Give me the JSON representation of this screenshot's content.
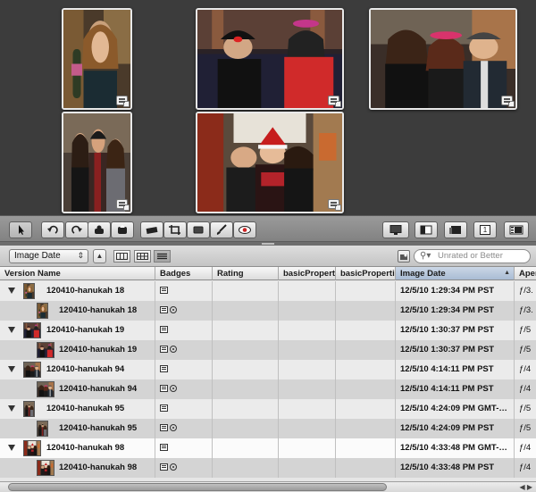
{
  "viewer": {
    "thumbnails": [
      {
        "scene": "woman-bottle"
      },
      {
        "scene": "party-couch"
      },
      {
        "scene": "three-friends"
      },
      {
        "scene": "three-hallway"
      },
      {
        "scene": "group-santa-hat"
      }
    ]
  },
  "toolbar": {
    "tools": [
      "pointer-icon",
      "rotate-left-icon",
      "rotate-right-icon",
      "stamp-icon",
      "lift-icon",
      "straighten-icon",
      "crop-icon",
      "redeye-rect-icon",
      "brush-icon",
      "eye-icon"
    ],
    "right_buttons": [
      "display-icon",
      "inspector-icon",
      "browser-icon",
      "single-view-icon",
      "filmstrip-icon"
    ],
    "single_view_label": "1"
  },
  "listbar": {
    "sort_value": "Image Date",
    "filter_placeholder": "Unrated or Better"
  },
  "table": {
    "columns": [
      "Version Name",
      "Badges",
      "Rating",
      "basicProperti",
      "basicProperti",
      "Image Date",
      "Aper"
    ],
    "rows": [
      {
        "type": "parent",
        "name": "120410-hanukah 18",
        "date": "12/5/10 1:29:34 PM PST",
        "aperture": "ƒ/3.",
        "badges": [
          "adj"
        ],
        "scene": "woman-bottle"
      },
      {
        "type": "child",
        "name": "120410-hanukah 18",
        "date": "12/5/10 1:29:34 PM PST",
        "aperture": "ƒ/3.",
        "badges": [
          "adj",
          "ver"
        ],
        "scene": "woman-bottle"
      },
      {
        "type": "parent",
        "name": "120410-hanukah 19",
        "date": "12/5/10 1:30:37 PM PST",
        "aperture": "ƒ/5",
        "badges": [
          "adj"
        ],
        "scene": "party-couch"
      },
      {
        "type": "child",
        "name": "120410-hanukah 19",
        "date": "12/5/10 1:30:37 PM PST",
        "aperture": "ƒ/5",
        "badges": [
          "adj",
          "ver"
        ],
        "scene": "party-couch"
      },
      {
        "type": "parent",
        "name": "120410-hanukah 94",
        "date": "12/5/10 4:14:11 PM PST",
        "aperture": "ƒ/4",
        "badges": [
          "adj"
        ],
        "scene": "three-friends"
      },
      {
        "type": "child",
        "name": "120410-hanukah 94",
        "date": "12/5/10 4:14:11 PM PST",
        "aperture": "ƒ/4",
        "badges": [
          "adj",
          "ver"
        ],
        "scene": "three-friends"
      },
      {
        "type": "parent",
        "name": "120410-hanukah 95",
        "date": "12/5/10 4:24:09 PM GMT-…",
        "aperture": "ƒ/5",
        "badges": [
          "adj"
        ],
        "scene": "three-hallway"
      },
      {
        "type": "child",
        "name": "120410-hanukah 95",
        "date": "12/5/10 4:24:09 PM PST",
        "aperture": "ƒ/5",
        "badges": [
          "adj",
          "ver"
        ],
        "scene": "three-hallway"
      },
      {
        "type": "parent",
        "name": "120410-hanukah 98",
        "date": "12/5/10 4:33:48 PM GMT-…",
        "aperture": "ƒ/4",
        "badges": [
          "adj"
        ],
        "scene": "group-santa-hat",
        "selected": true
      },
      {
        "type": "child",
        "name": "120410-hanukah 98",
        "date": "12/5/10 4:33:48 PM PST",
        "aperture": "ƒ/4",
        "badges": [
          "adj",
          "ver"
        ],
        "scene": "group-santa-hat"
      }
    ]
  }
}
